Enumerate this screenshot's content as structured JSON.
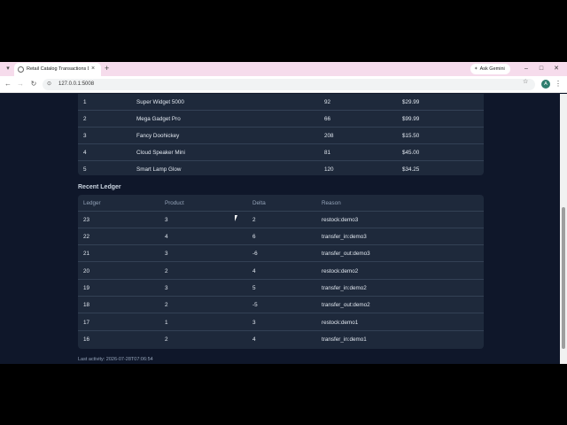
{
  "browser": {
    "tab_title": "Retail Catalog Transactions Da",
    "tab_close": "×",
    "new_tab": "+",
    "gemini_label": "Ask Gemini",
    "url": "127.0.0.1:5008",
    "profile_initial": "A",
    "window_minimize": "–",
    "window_maximize": "□",
    "window_close": "✕"
  },
  "products": {
    "rows": [
      {
        "id": "1",
        "name": "Super Widget 5000",
        "stock": "92",
        "price": "$29.99"
      },
      {
        "id": "2",
        "name": "Mega Gadget Pro",
        "stock": "66",
        "price": "$99.99"
      },
      {
        "id": "3",
        "name": "Fancy Doohickey",
        "stock": "208",
        "price": "$15.50"
      },
      {
        "id": "4",
        "name": "Cloud Speaker Mini",
        "stock": "81",
        "price": "$45.00"
      },
      {
        "id": "5",
        "name": "Smart Lamp Glow",
        "stock": "120",
        "price": "$34.25"
      }
    ]
  },
  "ledger": {
    "title": "Recent Ledger",
    "headers": {
      "ledger": "Ledger",
      "product": "Product",
      "delta": "Delta",
      "reason": "Reason"
    },
    "rows": [
      {
        "ledger": "23",
        "product": "3",
        "delta": "2",
        "reason": "restock:demo3"
      },
      {
        "ledger": "22",
        "product": "4",
        "delta": "6",
        "reason": "transfer_in:demo3"
      },
      {
        "ledger": "21",
        "product": "3",
        "delta": "-6",
        "reason": "transfer_out:demo3"
      },
      {
        "ledger": "20",
        "product": "2",
        "delta": "4",
        "reason": "restock:demo2"
      },
      {
        "ledger": "19",
        "product": "3",
        "delta": "5",
        "reason": "transfer_in:demo2"
      },
      {
        "ledger": "18",
        "product": "2",
        "delta": "-5",
        "reason": "transfer_out:demo2"
      },
      {
        "ledger": "17",
        "product": "1",
        "delta": "3",
        "reason": "restock:demo1"
      },
      {
        "ledger": "16",
        "product": "2",
        "delta": "4",
        "reason": "transfer_in:demo1"
      }
    ]
  },
  "footer": {
    "last_activity": "Last activity: 2026-07-28T07:06:54"
  }
}
